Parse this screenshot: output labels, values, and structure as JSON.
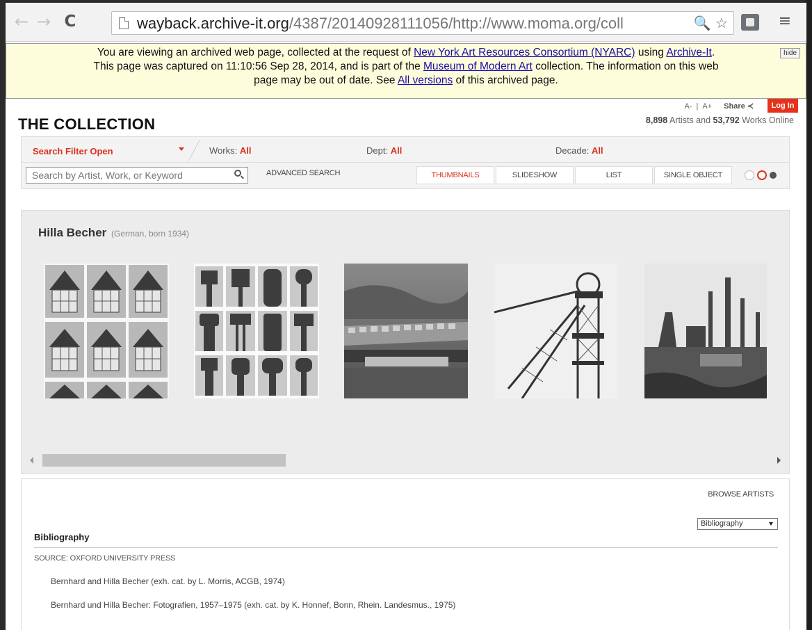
{
  "browser": {
    "url_host": "wayback.archive-it.org",
    "url_path": "/4387/20140928111056/http://www.moma.org/coll",
    "nav_back": "←",
    "nav_forward": "→",
    "nav_reload": "C",
    "omni_icons": "🔍 ☆",
    "menu": "≡"
  },
  "banner": {
    "line1_a": "You are viewing an archived web page, collected at the request of ",
    "line1_link1": "New York Art Resources Consortium (NYARC)",
    "line1_b": " using ",
    "line1_link2": "Archive-It",
    "line1_c": ".",
    "line2_a": "This page was captured on 11:10:56 Sep 28, 2014, and is part of the ",
    "line2_link": "Museum of Modern Art",
    "line2_b": " collection. The information on this web",
    "line3_a": "page may be out of date. See ",
    "line3_link": "All versions",
    "line3_b": " of this archived page.",
    "hide": "hide"
  },
  "header": {
    "title": "THE COLLECTION",
    "font_smaller": "A-",
    "font_sep": "|",
    "font_larger": "A+",
    "share": "Share ≺",
    "login": "Log In",
    "artists_count": "8,898",
    "artists_text": " Artists and ",
    "works_count": "53,792",
    "works_text": " Works Online"
  },
  "filters": {
    "search_filter": "Search Filter Open",
    "works_label": "Works: ",
    "works_value": "All",
    "dept_label": "Dept: ",
    "dept_value": "All",
    "decade_label": "Decade: ",
    "decade_value": "All"
  },
  "search": {
    "placeholder": "Search by Artist, Work, or Keyword",
    "advanced": "ADVANCED SEARCH"
  },
  "views": {
    "thumbnails": "THUMBNAILS",
    "slideshow": "SLIDESHOW",
    "list": "LIST",
    "single_object": "SINGLE OBJECT"
  },
  "artist": {
    "name": "Hilla Becher",
    "meta": "(German, born 1934)"
  },
  "bibliography": {
    "browse_artists": "BROWSE ARTISTS",
    "select_value": "Bibliography",
    "heading": "Bibliography",
    "source": "SOURCE: OXFORD UNIVERSITY PRESS",
    "entries": [
      "Bernhard and Hilla Becher (exh. cat. by L. Morris, ACGB, 1974)",
      "Bernhard und Hilla Becher: Fotografien, 1957–1975 (exh. cat. by K. Honnef, Bonn, Rhein. Landesmus., 1975)"
    ]
  },
  "colors": {
    "accent_red": "#d9321e",
    "banner_bg": "#fdfcdb",
    "link_blue": "#1a0dab"
  }
}
